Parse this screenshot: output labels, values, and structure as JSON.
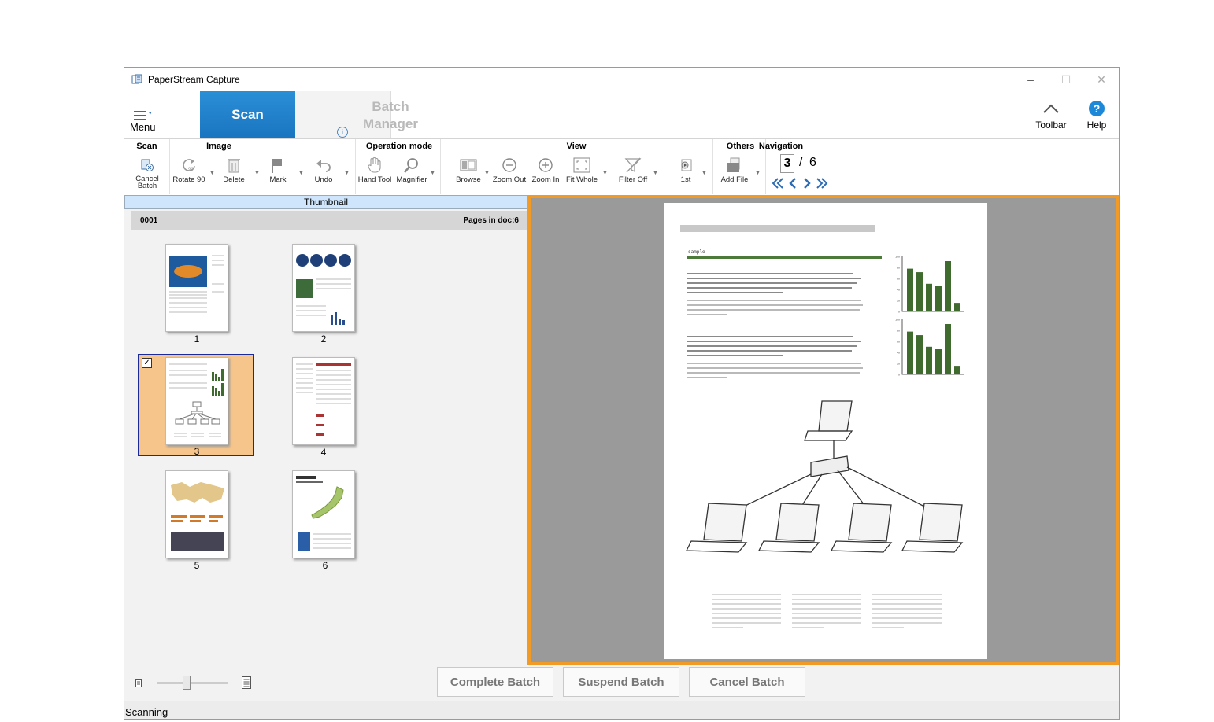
{
  "window": {
    "title": "PaperStream Capture",
    "minimize": "–",
    "maximize": "☐",
    "close": "✕"
  },
  "ribbon": {
    "menu_label": "Menu",
    "tabs": [
      {
        "label": "Scan"
      },
      {
        "label_line1": "Batch",
        "label_line2": "Manager"
      }
    ],
    "info_glyph": "i",
    "toolbar_label": "Toolbar",
    "help_label": "Help",
    "help_glyph": "?"
  },
  "groups": {
    "scan": {
      "title": "Scan",
      "cancel_l1": "Cancel",
      "cancel_l2": "Batch"
    },
    "image": {
      "title": "Image",
      "rotate": "Rotate 90",
      "rotate_badge": "90",
      "delete": "Delete",
      "mark": "Mark",
      "undo": "Undo"
    },
    "operation": {
      "title": "Operation mode",
      "hand": "Hand Tool",
      "magnifier": "Magnifier"
    },
    "view": {
      "title": "View",
      "browse": "Browse",
      "zoom_out": "Zoom Out",
      "zoom_in": "Zoom In",
      "fit_whole": "Fit Whole",
      "filter_off": "Filter Off",
      "first": "1st"
    },
    "others": {
      "title": "Others",
      "add_file": "Add File"
    },
    "navigation": {
      "title": "Navigation",
      "current": "3",
      "separator": "/",
      "total": "6"
    }
  },
  "thumbnail_panel": {
    "header": "Thumbnail",
    "doc_id": "0001",
    "pages_in_doc": "Pages in doc:6",
    "pages": [
      "1",
      "2",
      "3",
      "4",
      "5",
      "6"
    ],
    "selected_page": 3,
    "check_glyph": "✓"
  },
  "preview": {
    "heading": "sample",
    "para_text": "Every now and then you may come into the situation that you have to present some sort of statistical data to your client. Of course you may use Excel's graph tool to easily create a bunch of charts",
    "col_text": "HTML Validator is a Mozilla extension that adds HTML validation inside Firefox and Mozilla.",
    "chart_data": [
      {
        "type": "bar",
        "ylim": [
          0,
          100
        ],
        "yticks": [
          "100",
          "80",
          "60",
          "40",
          "20",
          "0"
        ],
        "values": [
          85,
          78,
          55,
          50,
          100,
          17
        ]
      },
      {
        "type": "bar",
        "ylim": [
          0,
          100
        ],
        "yticks": [
          "100",
          "80",
          "60",
          "40",
          "20",
          "0"
        ],
        "values": [
          85,
          78,
          55,
          50,
          100,
          17
        ]
      }
    ]
  },
  "bottom": {
    "complete": "Complete Batch",
    "suspend": "Suspend Batch",
    "cancel": "Cancel Batch",
    "slider_fraction": 0.4
  },
  "status": "Scanning",
  "colors": {
    "scan_tab": "#1a74c0",
    "accent": "#f29a26",
    "selection": "#f6c58b",
    "nav_blue": "#2b6cb5",
    "chart_bar": "#3f6b2e"
  }
}
